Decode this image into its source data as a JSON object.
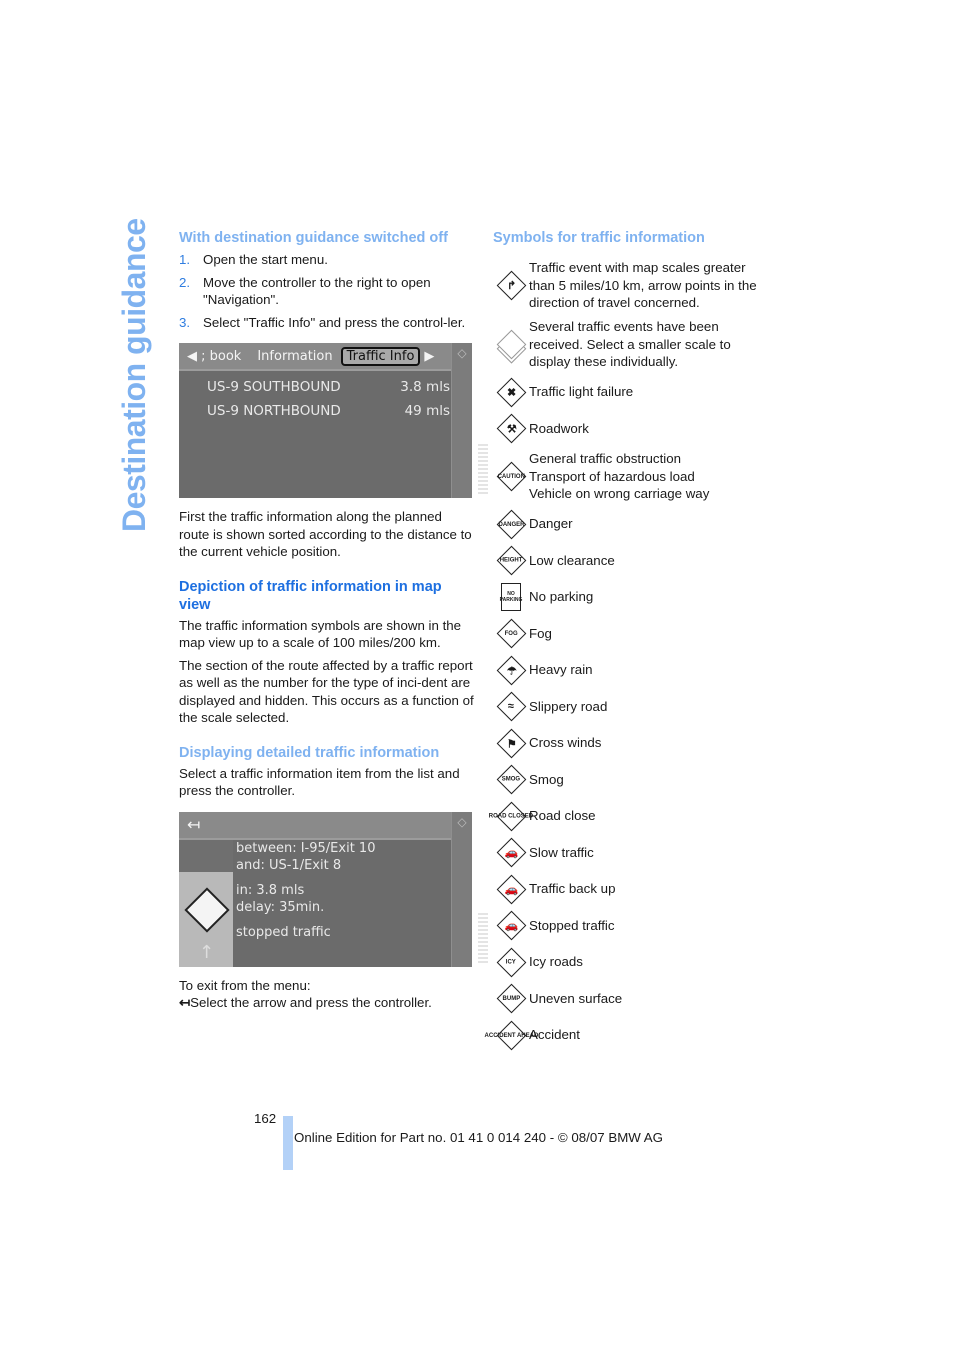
{
  "side_title": "Destination guidance",
  "left": {
    "section1": {
      "heading": "With destination guidance switched off",
      "steps": [
        {
          "num": "1.",
          "text": "Open the start menu."
        },
        {
          "num": "2.",
          "text": "Move the controller to the right to open \"Navigation\"."
        },
        {
          "num": "3.",
          "text": "Select \"Traffic Info\" and press the control-ler."
        }
      ]
    },
    "screen1": {
      "tabs": [
        "◀ ; book",
        "Information",
        "Traffic Info",
        "▶"
      ],
      "active_tab": "Traffic Info",
      "rows": [
        {
          "road": "US-9 SOUTHBOUND",
          "distance": "3.8 mls"
        },
        {
          "road": "US-9 NORTHBOUND",
          "distance": "49 mls"
        }
      ]
    },
    "para1": "First the traffic information along the planned route is shown sorted according to the distance to the current vehicle position.",
    "section2": {
      "heading": "Depiction of traffic information in map view",
      "para1": "The traffic information symbols are shown in the map view up to a scale of 100 miles/200 km.",
      "para2": "The section of the route affected by a traffic report as well as the number for the type of inci-dent are displayed and hidden. This occurs as a function of the scale selected."
    },
    "section3": {
      "heading": "Displaying detailed traffic information",
      "para": "Select a traffic information item from the list and press the controller."
    },
    "screen2": {
      "back_icon": "↤",
      "lines": [
        "between: I-95/Exit 10",
        "and: US-1/Exit 8",
        "in: 3.8 mls",
        "delay: 35min.",
        "stopped traffic"
      ]
    },
    "exit_text": "To exit from the menu:",
    "exit_instruction": "Select the arrow and press the controller."
  },
  "right": {
    "heading": "Symbols for traffic information",
    "symbols": [
      {
        "icon": "arrow-turn-icon",
        "label": "↱",
        "text": "Traffic event with map scales greater than 5 miles/10 km, arrow points in the direction of travel concerned."
      },
      {
        "icon": "multiple-events-icon",
        "label": "",
        "text": "Several traffic events have been received. Select a smaller scale to display these individually."
      },
      {
        "icon": "traffic-light-failure-icon",
        "label": "✖",
        "text": "Traffic light failure"
      },
      {
        "icon": "roadwork-icon",
        "label": "⚒",
        "text": "Roadwork"
      },
      {
        "icon": "caution-icon",
        "label": "CAUTION",
        "text": "General traffic obstruction\nTransport of hazardous load\nVehicle on wrong carriage way"
      },
      {
        "icon": "danger-icon",
        "label": "DANGER",
        "text": "Danger"
      },
      {
        "icon": "height-icon",
        "label": "HEIGHT",
        "text": "Low clearance"
      },
      {
        "icon": "no-parking-icon",
        "label": "NO PARKING",
        "text": "No parking"
      },
      {
        "icon": "fog-icon",
        "label": "FOG",
        "text": "Fog"
      },
      {
        "icon": "heavy-rain-icon",
        "label": "☂",
        "text": "Heavy rain"
      },
      {
        "icon": "slippery-road-icon",
        "label": "≈",
        "text": "Slippery road"
      },
      {
        "icon": "cross-winds-icon",
        "label": "⚑",
        "text": "Cross winds"
      },
      {
        "icon": "smog-icon",
        "label": "SMOG",
        "text": "Smog"
      },
      {
        "icon": "road-closed-icon",
        "label": "ROAD CLOSED",
        "text": "Road close"
      },
      {
        "icon": "slow-traffic-icon",
        "label": "🚗",
        "text": "Slow traffic"
      },
      {
        "icon": "traffic-back-up-icon",
        "label": "🚗",
        "text": "Traffic back up"
      },
      {
        "icon": "stopped-traffic-icon",
        "label": "🚗",
        "text": "Stopped traffic"
      },
      {
        "icon": "icy-roads-icon",
        "label": "ICY",
        "text": "Icy roads"
      },
      {
        "icon": "bump-icon",
        "label": "BUMP",
        "text": "Uneven surface"
      },
      {
        "icon": "accident-icon",
        "label": "ACCIDENT AHEAD",
        "text": "Accident"
      }
    ]
  },
  "footer": {
    "page_number": "162",
    "edition": "Online Edition for Part no. 01 41 0 014 240 - © 08/07 BMW AG"
  }
}
